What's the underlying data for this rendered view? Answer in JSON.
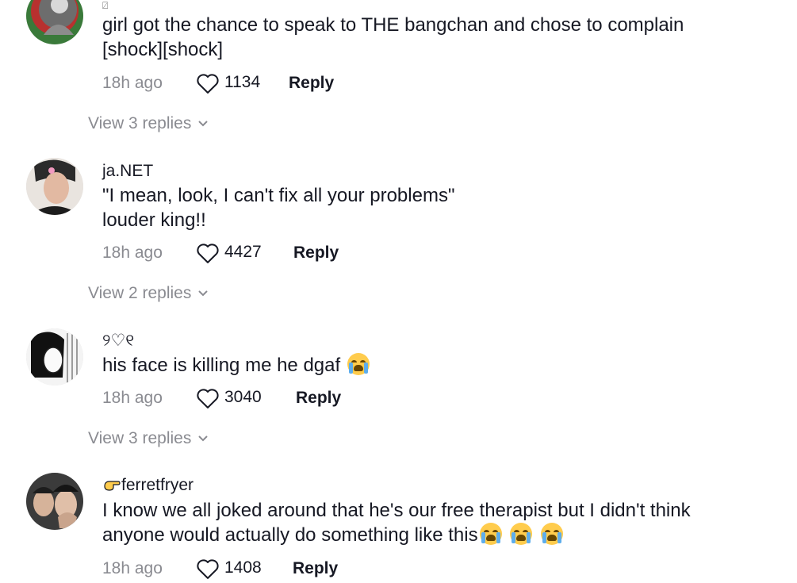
{
  "comments": [
    {
      "username": "",
      "username_icon": "broken-image-icon",
      "lines": [
        "girl got the chance to speak to THE bangchan and chose to complain",
        "[shock][shock]"
      ],
      "time": "18h ago",
      "likes": "1134",
      "reply_label": "Reply",
      "view_replies": "View 3 replies"
    },
    {
      "username": "ja.NET",
      "lines": [
        "\"I mean, look, I can't fix all your problems\"",
        "louder king!!"
      ],
      "time": "18h ago",
      "likes": "4427",
      "reply_label": "Reply",
      "view_replies": "View 2 replies"
    },
    {
      "username": "୨♡୧",
      "lines": [
        "his face is killing me he dgaf"
      ],
      "trailing_emoji": [
        "loudly-crying-face"
      ],
      "time": "18h ago",
      "likes": "3040",
      "reply_label": "Reply",
      "view_replies": "View 3 replies"
    },
    {
      "username": "ferretfryer",
      "username_prefix_icon": "hand-point-icon",
      "lines": [
        "I know we all joked around that he's our free therapist but I didn't think",
        "anyone would actually do something like this"
      ],
      "trailing_emoji": [
        "loudly-crying-face",
        "loudly-crying-face",
        "loudly-crying-face"
      ],
      "time": "18h ago",
      "likes": "1408",
      "reply_label": "Reply"
    }
  ],
  "colors": {
    "text": "#161823",
    "muted": "#8a8b91",
    "background": "#ffffff"
  }
}
